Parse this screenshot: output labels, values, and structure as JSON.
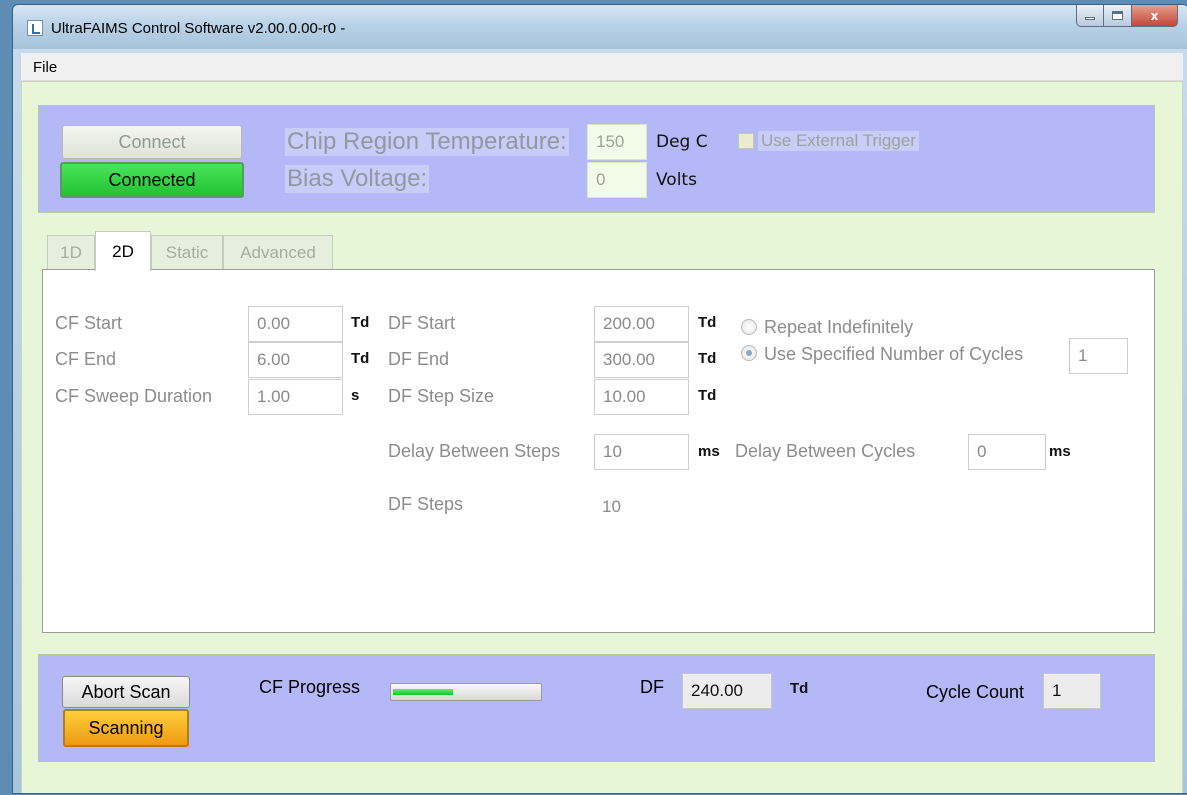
{
  "window": {
    "title": "UltraFAIMS Control Software v2.00.0.00-r0 -",
    "controls": {
      "minimize": "minimize-icon",
      "maximize": "maximize-icon",
      "close": "x"
    }
  },
  "menu": {
    "file": "File"
  },
  "connection": {
    "connect_label": "Connect",
    "status_label": "Connected",
    "status_color": "#22c234"
  },
  "settings": {
    "chip_temp_label": "Chip Region Temperature:",
    "chip_temp_value": "150",
    "chip_temp_unit": "Deg C",
    "bias_label": "Bias Voltage:",
    "bias_value": "0",
    "bias_unit": "Volts",
    "external_trigger_label": "Use External Trigger",
    "external_trigger_checked": false
  },
  "tabs": [
    {
      "label": "1D",
      "active": false
    },
    {
      "label": "2D",
      "active": true
    },
    {
      "label": "Static",
      "active": false
    },
    {
      "label": "Advanced",
      "active": false
    }
  ],
  "scan2d": {
    "cf_start_label": "CF Start",
    "cf_start_value": "0.00",
    "cf_start_unit": "Td",
    "cf_end_label": "CF End",
    "cf_end_value": "6.00",
    "cf_end_unit": "Td",
    "cf_sweep_label": "CF Sweep Duration",
    "cf_sweep_value": "1.00",
    "cf_sweep_unit": "s",
    "df_start_label": "DF Start",
    "df_start_value": "200.00",
    "df_start_unit": "Td",
    "df_end_label": "DF End",
    "df_end_value": "300.00",
    "df_end_unit": "Td",
    "df_step_label": "DF Step Size",
    "df_step_value": "10.00",
    "df_step_unit": "Td",
    "delay_steps_label": "Delay Between Steps",
    "delay_steps_value": "10",
    "delay_steps_unit": "ms",
    "delay_cycles_label": "Delay Between Cycles",
    "delay_cycles_value": "0",
    "delay_cycles_unit": "ms",
    "df_steps_label": "DF Steps",
    "df_steps_value": "10",
    "repeat_label": "Repeat Indefinitely",
    "repeat_selected": false,
    "cycles_label": "Use Specified Number of Cycles",
    "cycles_selected": true,
    "cycles_value": "1"
  },
  "status": {
    "abort_label": "Abort Scan",
    "scanning_label": "Scanning",
    "cf_progress_label": "CF Progress",
    "cf_progress_fraction": 0.41,
    "df_label": "DF",
    "df_value": "240.00",
    "df_unit": "Td",
    "cycle_count_label": "Cycle Count",
    "cycle_count_value": "1"
  }
}
